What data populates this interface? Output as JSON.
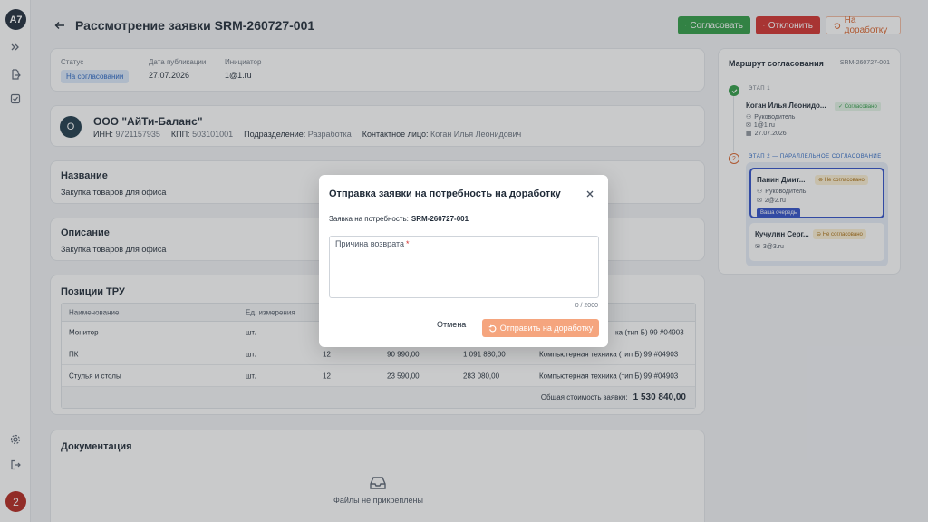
{
  "app": {
    "logo_text": "A7",
    "user_badge": "2"
  },
  "header": {
    "title": "Рассмотрение заявки SRM-260727-001",
    "approve_label": "Согласовать",
    "reject_label": "Отклонить",
    "rework_label": "На доработку"
  },
  "status": {
    "status_label": "Статус",
    "status_value": "На согласовании",
    "date_label": "Дата публикации",
    "date_value": "27.07.2026",
    "initiator_label": "Инициатор",
    "initiator_value": "1@1.ru"
  },
  "org": {
    "avatar_letter": "О",
    "name": "ООО \"АйТи-Баланс\"",
    "inn_label": "ИНН:",
    "inn": "9721157935",
    "kpp_label": "КПП:",
    "kpp": "503101001",
    "dept_label": "Подразделение:",
    "dept": "Разработка",
    "contact_label": "Контактное лицо:",
    "contact": "Коган Илья Леонидович"
  },
  "name_section": {
    "title": "Название",
    "body": "Закупка товаров для офиса"
  },
  "desc_section": {
    "title": "Описание",
    "body": "Закупка товаров для офиса"
  },
  "items": {
    "title": "Позиции ТРУ",
    "headers": [
      "Наименование",
      "Ед. измерения"
    ],
    "rows": [
      {
        "name": "Монитор",
        "unit": "шт.",
        "qty": "",
        "price": "",
        "sum": "",
        "cat": "ка (тип Б) 99 #04903"
      },
      {
        "name": "ПК",
        "unit": "шт.",
        "qty": "12",
        "price": "90 990,00",
        "sum": "1 091 880,00",
        "cat": "Компьютерная техника (тип Б) 99 #04903"
      },
      {
        "name": "Стулья и столы",
        "unit": "шт.",
        "qty": "12",
        "price": "23 590,00",
        "sum": "283 080,00",
        "cat": "Компьютерная техника (тип Б) 99 #04903"
      }
    ],
    "total_label": "Общая стоимость заявки:",
    "total_value": "1 530 840,00"
  },
  "docs": {
    "title": "Документация",
    "empty_text": "Файлы не прикреплены"
  },
  "route": {
    "title": "Маршрут согласования",
    "code": "SRM-260727-001",
    "stage1_label": "ЭТАП 1",
    "stage2_label": "ЭТАП 2 — ПАРАЛЛЕЛЬНОЕ СОГЛАСОВАНИЕ",
    "stage2_number": "2",
    "person1": {
      "name": "Коган Илья Леонидо...",
      "badge": "Согласовано",
      "role": "Руководитель",
      "email": "1@1.ru",
      "date": "27.07.2026"
    },
    "person2": {
      "name": "Панин Дмит...",
      "badge": "Не согласовано",
      "role": "Руководитель",
      "email": "2@2.ru",
      "queue": "Ваша очередь"
    },
    "person3": {
      "name": "Кучулин Серг...",
      "badge": "Не согласовано",
      "email": "3@3.ru"
    }
  },
  "modal": {
    "title": "Отправка заявки на потребность на доработку",
    "subtitle_label": "Заявка на потребность:",
    "subtitle_value": "SRM-260727-001",
    "reason_label": "Причина возврата",
    "reason_required": "*",
    "reason_value": "",
    "counter": "0 / 2000",
    "cancel_label": "Отмена",
    "submit_label": "Отправить на доработку"
  }
}
